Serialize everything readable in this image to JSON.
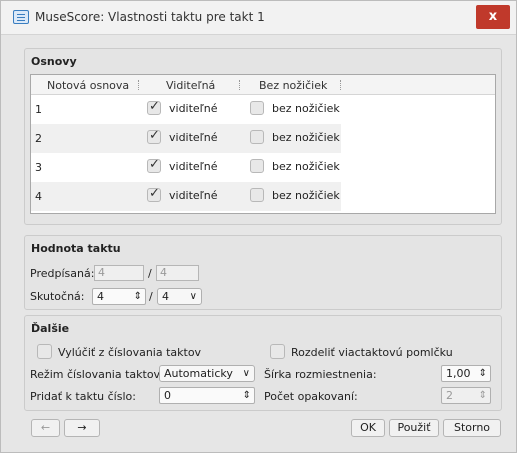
{
  "window": {
    "title": "MuseScore: Vlastnosti taktu pre takt 1",
    "close_label": "x"
  },
  "staves": {
    "title": "Osnovy",
    "columns": [
      "Notová osnova",
      "Viditeľná",
      "Bez nožičiek"
    ],
    "rows": [
      {
        "num": "1",
        "visible_checked": true,
        "visible_label": "viditeľné",
        "stemless_checked": false,
        "stemless_label": "bez nožičiek"
      },
      {
        "num": "2",
        "visible_checked": true,
        "visible_label": "viditeľné",
        "stemless_checked": false,
        "stemless_label": "bez nožičiek"
      },
      {
        "num": "3",
        "visible_checked": true,
        "visible_label": "viditeľné",
        "stemless_checked": false,
        "stemless_label": "bez nožičiek"
      },
      {
        "num": "4",
        "visible_checked": true,
        "visible_label": "viditeľné",
        "stemless_checked": false,
        "stemless_label": "bez nožičiek"
      }
    ]
  },
  "duration": {
    "title": "Hodnota taktu",
    "nominal_label": "Predpísaná:",
    "nominal_num": "4",
    "nominal_den": "4",
    "actual_label": "Skutočná:",
    "actual_num": "4",
    "actual_den": "4",
    "slash": "/"
  },
  "other": {
    "title": "Ďalšie",
    "exclude_label": "Vylúčiť z číslovania taktov",
    "exclude_checked": false,
    "break_label": "Rozdeliť viactaktovú pomlčku",
    "break_checked": false,
    "numbering_label": "Režim číslovania taktov:",
    "numbering_value": "Automaticky",
    "stretch_label": "Šírka rozmiestnenia:",
    "stretch_value": "1,00",
    "add_label": "Pridať k taktu číslo:",
    "add_value": "0",
    "repeat_label": "Počet opakovaní:",
    "repeat_value": "2"
  },
  "buttons": {
    "prev": "←",
    "next": "→",
    "ok": "OK",
    "apply": "Použiť",
    "cancel": "Storno"
  }
}
